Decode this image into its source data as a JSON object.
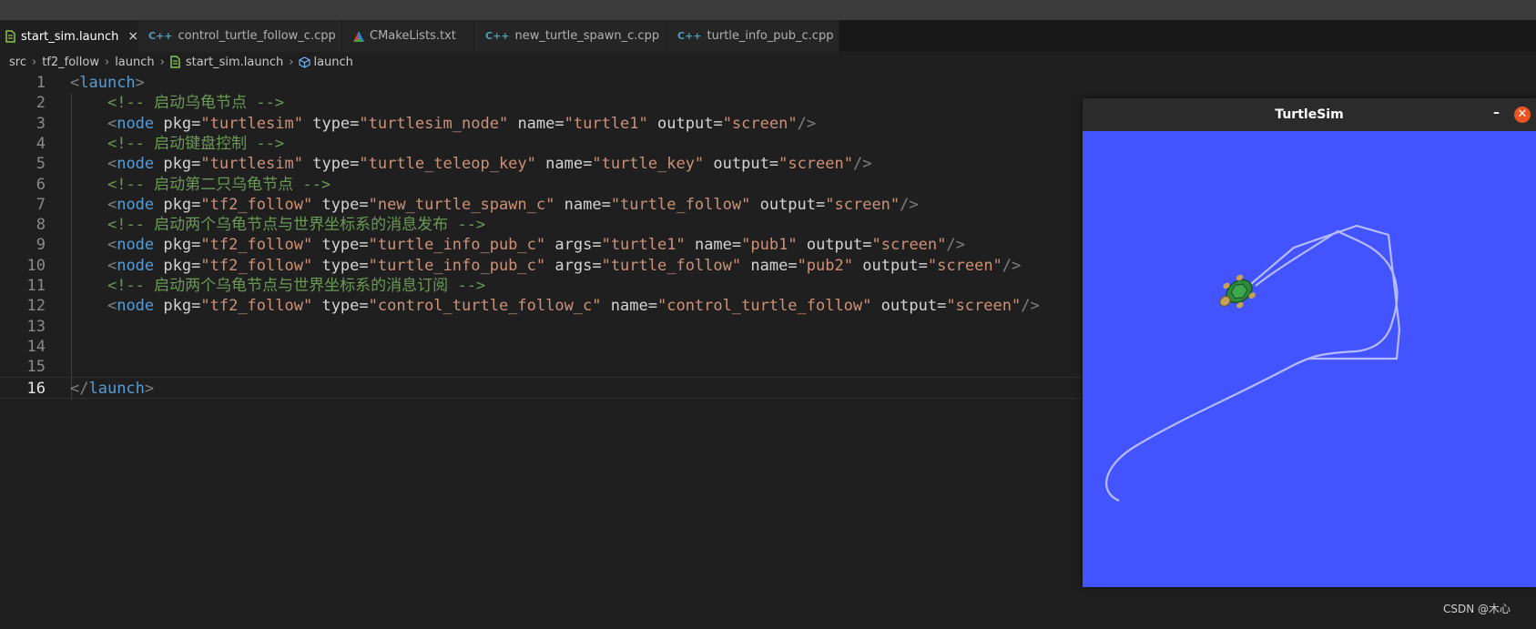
{
  "tabs": [
    {
      "label": "start_sim.launch",
      "icon": "launch-file-icon",
      "close": "×",
      "active": true
    },
    {
      "label": "control_turtle_follow_c.cpp",
      "icon": "cpp-file-icon",
      "active": false
    },
    {
      "label": "CMakeLists.txt",
      "icon": "cmake-file-icon",
      "active": false
    },
    {
      "label": "new_turtle_spawn_c.cpp",
      "icon": "cpp-file-icon",
      "active": false
    },
    {
      "label": "turtle_info_pub_c.cpp",
      "icon": "cpp-file-icon",
      "active": false
    }
  ],
  "breadcrumb": [
    "src",
    "tf2_follow",
    "launch",
    "start_sim.launch",
    "launch"
  ],
  "editor": {
    "line_numbers": [
      "1",
      "2",
      "3",
      "4",
      "5",
      "6",
      "7",
      "8",
      "9",
      "10",
      "11",
      "12",
      "13",
      "14",
      "15",
      "16"
    ],
    "current_line": "16",
    "lines": [
      "<launch>",
      "    <!-- 启动乌龟节点 -->",
      "    <node pkg=\"turtlesim\" type=\"turtlesim_node\" name=\"turtle1\" output=\"screen\"/>",
      "    <!-- 启动键盘控制 -->",
      "    <node pkg=\"turtlesim\" type=\"turtle_teleop_key\" name=\"turtle_key\" output=\"screen\"/>",
      "    <!-- 启动第二只乌龟节点 -->",
      "    <node pkg=\"tf2_follow\" type=\"new_turtle_spawn_c\" name=\"turtle_follow\" output=\"screen\"/>",
      "    <!-- 启动两个乌龟节点与世界坐标系的消息发布 -->",
      "    <node pkg=\"tf2_follow\" type=\"turtle_info_pub_c\" args=\"turtle1\" name=\"pub1\" output=\"screen\"/>",
      "    <node pkg=\"tf2_follow\" type=\"turtle_info_pub_c\" args=\"turtle_follow\" name=\"pub2\" output=\"screen\"/>",
      "    <!-- 启动两个乌龟节点与世界坐标系的消息订阅 -->",
      "    <node pkg=\"tf2_follow\" type=\"control_turtle_follow_c\" name=\"control_turtle_follow\" output=\"screen\"/>",
      "",
      "",
      "",
      "</launch>"
    ]
  },
  "turtlesim": {
    "title": "TurtleSim",
    "minimize": "–",
    "close": "✕",
    "background_color": "#4353fe",
    "trail_color": "#b4bcff"
  },
  "watermark": "CSDN @木心",
  "colors": {
    "comment": "#6a9955",
    "tag": "#569cd6",
    "attribute": "#9cdcfe",
    "string": "#ce9178"
  }
}
